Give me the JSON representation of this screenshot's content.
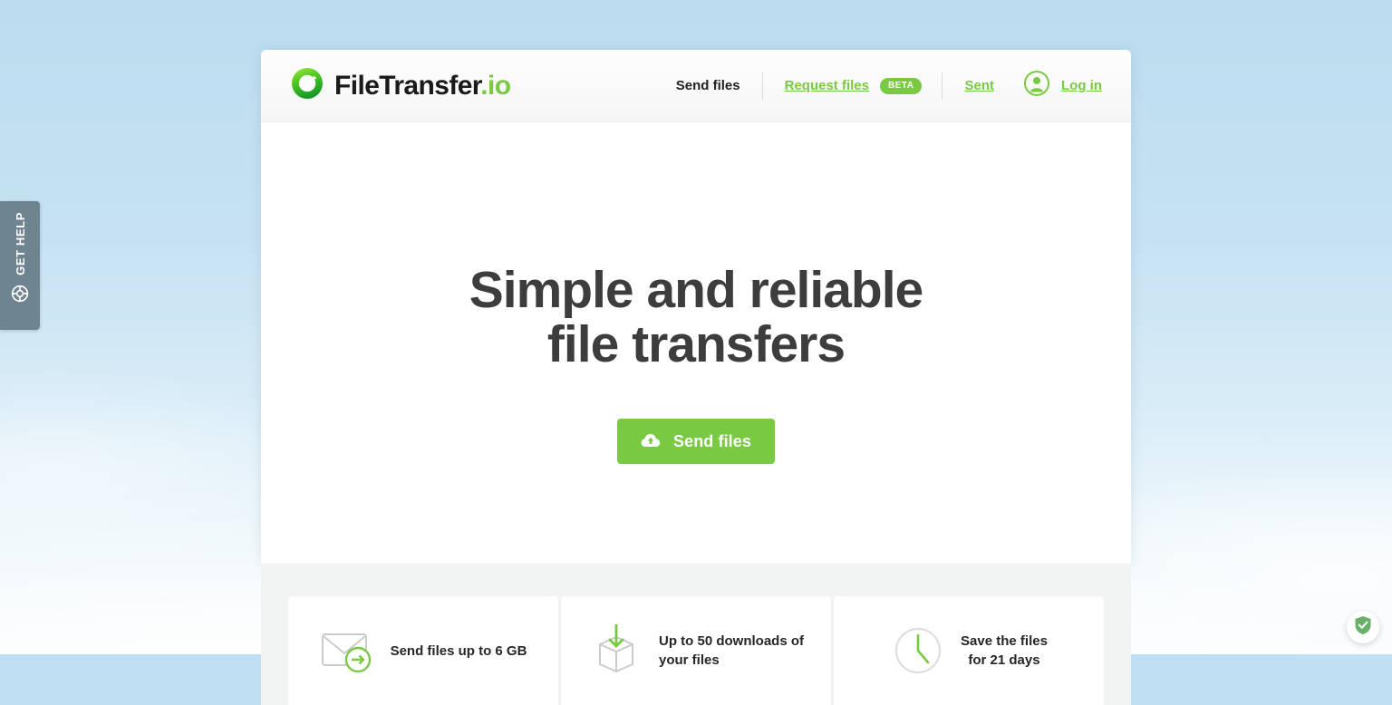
{
  "background": {
    "sky_color_top": "#bcdcf0",
    "sky_color_bottom": "#f9fcfd"
  },
  "help_tab": {
    "label": "GET HELP",
    "icon": "lifebuoy-icon",
    "bg_color": "#6f8491"
  },
  "header": {
    "logo": {
      "name": "FileTransfer",
      "tld": ".io",
      "icon": "filetransfer-ring-logo",
      "accent": "#7ac943"
    },
    "nav": [
      {
        "label": "Send files",
        "style": "plain",
        "badge": null
      },
      {
        "label": "Request files",
        "style": "link",
        "badge": "BETA"
      },
      {
        "label": "Sent",
        "style": "link",
        "badge": null
      }
    ],
    "login": {
      "label": "Log in",
      "icon": "user-avatar-icon"
    }
  },
  "hero": {
    "title_line1": "Simple and reliable",
    "title_line2": "file transfers",
    "title_color": "#3d3d3d",
    "cta": {
      "label": "Send files",
      "icon": "cloud-upload-icon",
      "color": "#7ac943"
    }
  },
  "features": [
    {
      "icon": "envelope-send-icon",
      "text_line1": "Send files up to 6 GB",
      "text_line2": "",
      "align": "left"
    },
    {
      "icon": "box-download-icon",
      "text_line1": "Up to 50 downloads of",
      "text_line2": "your files",
      "align": "left"
    },
    {
      "icon": "clock-icon",
      "text_line1": "Save the files",
      "text_line2": "for 21 days",
      "align": "center"
    }
  ],
  "overlay": {
    "shield_badge": {
      "icon": "shield-check-icon",
      "color": "#67b168"
    }
  }
}
